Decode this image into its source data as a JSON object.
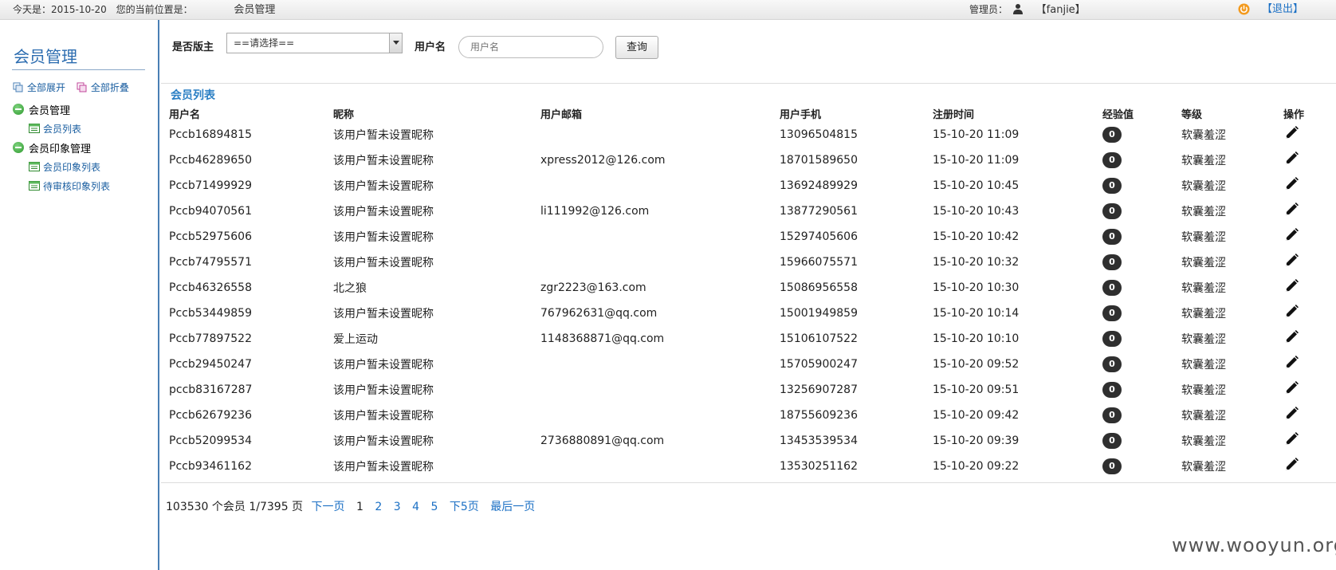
{
  "topbar": {
    "today": "今天是：2015-10-20",
    "location_label": "您的当前位置是：",
    "location": "会员管理",
    "admin_label": "管理员：",
    "admin_name": "【fanjie】",
    "logout": "【退出】"
  },
  "sidebar": {
    "title": "会员管理",
    "expand_all": "全部展开",
    "collapse_all": "全部折叠",
    "tree": [
      {
        "label": "会员管理",
        "children": [
          "会员列表"
        ]
      },
      {
        "label": "会员印象管理",
        "children": [
          "会员印象列表",
          "待审核印象列表"
        ]
      }
    ]
  },
  "filter": {
    "moderator_label": "是否版主",
    "moderator_value": "==请选择==",
    "username_label": "用户名",
    "username_placeholder": "用户名",
    "query_button": "查询"
  },
  "list": {
    "title": "会员列表",
    "columns": [
      "用户名",
      "昵称",
      "用户邮箱",
      "用户手机",
      "注册时间",
      "经验值",
      "等级",
      "操作"
    ],
    "rows": [
      [
        "Pccb16894815",
        "该用户暂未设置昵称",
        "",
        "13096504815",
        "15-10-20 11:09",
        "0",
        "软囊羞涩"
      ],
      [
        "Pccb46289650",
        "该用户暂未设置昵称",
        "xpress2012@126.com",
        "18701589650",
        "15-10-20 11:09",
        "0",
        "软囊羞涩"
      ],
      [
        "Pccb71499929",
        "该用户暂未设置昵称",
        "",
        "13692489929",
        "15-10-20 10:45",
        "0",
        "软囊羞涩"
      ],
      [
        "Pccb94070561",
        "该用户暂未设置昵称",
        "li111992@126.com",
        "13877290561",
        "15-10-20 10:43",
        "0",
        "软囊羞涩"
      ],
      [
        "Pccb52975606",
        "该用户暂未设置昵称",
        "",
        "15297405606",
        "15-10-20 10:42",
        "0",
        "软囊羞涩"
      ],
      [
        "Pccb74795571",
        "该用户暂未设置昵称",
        "",
        "15966075571",
        "15-10-20 10:32",
        "0",
        "软囊羞涩"
      ],
      [
        "Pccb46326558",
        "北之狼",
        "zgr2223@163.com",
        "15086956558",
        "15-10-20 10:30",
        "0",
        "软囊羞涩"
      ],
      [
        "Pccb53449859",
        "该用户暂未设置昵称",
        "767962631@qq.com",
        "15001949859",
        "15-10-20 10:14",
        "0",
        "软囊羞涩"
      ],
      [
        "Pccb77897522",
        "爱上运动",
        "1148368871@qq.com",
        "15106107522",
        "15-10-20 10:10",
        "0",
        "软囊羞涩"
      ],
      [
        "Pccb29450247",
        "该用户暂未设置昵称",
        "",
        "15705900247",
        "15-10-20 09:52",
        "0",
        "软囊羞涩"
      ],
      [
        "pccb83167287",
        "该用户暂未设置昵称",
        "",
        "13256907287",
        "15-10-20 09:51",
        "0",
        "软囊羞涩"
      ],
      [
        "Pccb62679236",
        "该用户暂未设置昵称",
        "",
        "18755609236",
        "15-10-20 09:42",
        "0",
        "软囊羞涩"
      ],
      [
        "Pccb52099534",
        "该用户暂未设置昵称",
        "2736880891@qq.com",
        "13453539534",
        "15-10-20 09:39",
        "0",
        "软囊羞涩"
      ],
      [
        "Pccb93461162",
        "该用户暂未设置昵称",
        "",
        "13530251162",
        "15-10-20 09:22",
        "0",
        "软囊羞涩"
      ]
    ]
  },
  "pager": {
    "info": "103530 个会员 1/7395 页",
    "next": "下一页",
    "current": "1",
    "pages": [
      "2",
      "3",
      "4",
      "5"
    ],
    "next5": "下5页",
    "last": "最后一页"
  },
  "watermark": "www.wooyun.org",
  "colors": {
    "accent": "#2b7fc4",
    "link": "#1a6fc4",
    "sidebar_border": "#4a7fb5",
    "badge": "#2f2f2f"
  }
}
